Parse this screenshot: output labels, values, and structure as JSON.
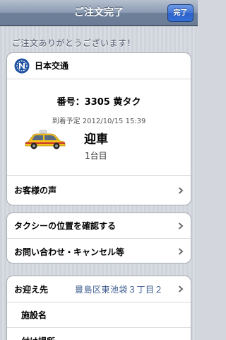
{
  "nav": {
    "title": "ご注文完了",
    "done_label": "完了"
  },
  "thanks": "ご注文ありがとうございます！",
  "order": {
    "company": "日本交通",
    "number": "番号：3305 黄タク",
    "eta": "到着予定 2012/10/15 15:39",
    "status": "迎車",
    "unit": "1台目",
    "feedback_label": "お客様の声"
  },
  "actions": [
    {
      "label": "タクシーの位置を確認する"
    },
    {
      "label": "お問い合わせ・キャンセル等"
    }
  ],
  "pickup": {
    "label": "お迎え先",
    "value": "豊島区東池袋３丁目２",
    "facility_label": "施設名",
    "spot_label": "付け場所"
  },
  "colors": {
    "accent": "#3470d8",
    "link_value": "#3a5a8c",
    "taxi_yellow": "#f3c21b"
  },
  "icons": {
    "logo": "nihon-kotsu-logo-icon",
    "taxi": "taxi-icon",
    "chevron": "chevron-right-icon"
  }
}
